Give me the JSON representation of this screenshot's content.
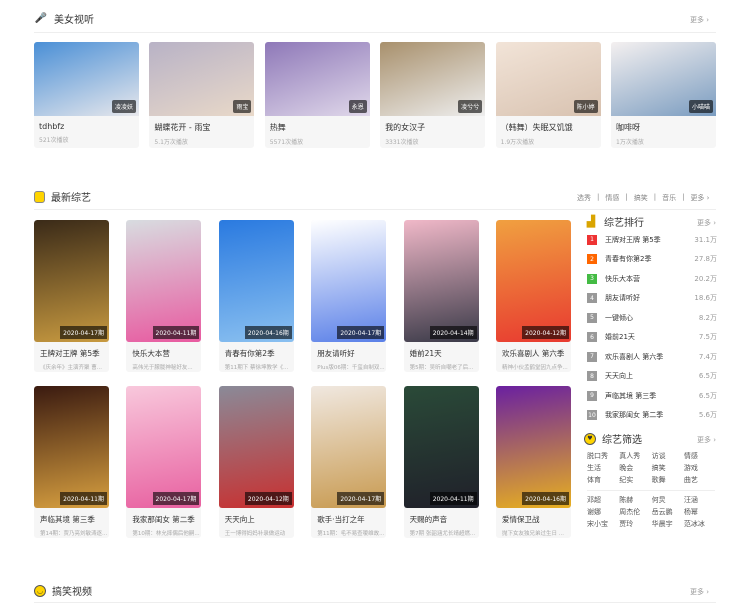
{
  "beauty": {
    "title": "美女视听",
    "more": "更多",
    "icon": "microphone-icon",
    "items": [
      {
        "title": "tdhbfz",
        "views": "521次播放",
        "tag": "凌凌妖",
        "colors": [
          "#4a8fd6",
          "#e8e8ec"
        ]
      },
      {
        "title": "蝴蝶花开 - 雨宝",
        "views": "5.1万次播放",
        "tag": "雨宝",
        "colors": [
          "#b8b2c6",
          "#e9d9c9"
        ]
      },
      {
        "title": "热舞",
        "views": "5571次播放",
        "tag": "永恩",
        "colors": [
          "#8e78b8",
          "#e0d8ea"
        ]
      },
      {
        "title": "我的女汉子",
        "views": "3331次播放",
        "tag": "凌兮兮",
        "colors": [
          "#a8906c",
          "#eeeeee"
        ]
      },
      {
        "title": "（韩舞）失眠又饥饿",
        "views": "1.9万次播放",
        "tag": "陈小婷",
        "colors": [
          "#f2e4d8",
          "#d8c2b0"
        ]
      },
      {
        "title": "咖啡呀",
        "views": "1万次播放",
        "tag": "小喵喵",
        "colors": [
          "#f4f0f0",
          "#7a9cc0"
        ]
      }
    ]
  },
  "variety": {
    "title": "最新综艺",
    "icon": "variety-icon",
    "categories": [
      "选秀",
      "情感",
      "搞笑",
      "音乐",
      "更多"
    ],
    "items": [
      {
        "title": "王牌对王牌 第5季",
        "desc": "《庆余年》主演齐聚 曹...",
        "date": "2020-04-17期",
        "colors": [
          "#3a2a18",
          "#c89a40"
        ]
      },
      {
        "title": "快乐大本营",
        "desc": "高伟光于朦胧神秘好友...",
        "date": "2020-04-11期",
        "colors": [
          "#d8dce0",
          "#e85aa0"
        ]
      },
      {
        "title": "青春有你第2季",
        "desc": "第11期下 蔡徐坤教学《...",
        "date": "2020-04-16期",
        "colors": [
          "#2a7ae0",
          "#8ac0f0"
        ]
      },
      {
        "title": "朋友请听好",
        "desc": "Plus版06期：千玺自制双...",
        "date": "2020-04-17期",
        "colors": [
          "#ffffff",
          "#5a80e8"
        ]
      },
      {
        "title": "婚前21天",
        "desc": "第5期：吴昕自嘲老了后...",
        "date": "2020-04-14期",
        "colors": [
          "#f0b8c8",
          "#3a3a48"
        ]
      },
      {
        "title": "欢乐喜剧人 第六季",
        "desc": "精神小伙孟鹤堂因九点争...",
        "date": "2020-04-12期",
        "colors": [
          "#f0a040",
          "#e83a30"
        ]
      },
      {
        "title": "声临其境 第三季",
        "desc": "第14期：贾乃亮刘敏涛逐...",
        "date": "2020-04-11期",
        "colors": [
          "#3a1a10",
          "#d8a040"
        ]
      },
      {
        "title": "我家那闺女 第二季",
        "desc": "第10期：林允摔偶后他嗣...",
        "date": "2020-04-17期",
        "colors": [
          "#f8c8dc",
          "#e860a0"
        ]
      },
      {
        "title": "天天向上",
        "desc": "王一博得妈妈补录做运动",
        "date": "2020-04-12期",
        "colors": [
          "#8a8a98",
          "#c83030"
        ]
      },
      {
        "title": "歌手·当打之年",
        "desc": "第11期：毛不易查嗄维故...",
        "date": "2020-04-17期",
        "colors": [
          "#f0e8e0",
          "#c89a50"
        ]
      },
      {
        "title": "天赐的声音",
        "desc": "第7期 张韶涵尤长靖超燃...",
        "date": "2020-04-11期",
        "colors": [
          "#2a4a38",
          "#20202a"
        ]
      },
      {
        "title": "爱情保卫战",
        "desc": "抛下女友独兄弟过生日 ...",
        "date": "2020-04-16期",
        "colors": [
          "#6a20a0",
          "#e8b020"
        ]
      }
    ]
  },
  "ranking": {
    "title": "综艺排行",
    "more": "更多",
    "icon": "bar-chart-icon",
    "rank_colors": [
      "#e33",
      "#f60",
      "#4b4",
      "#999"
    ],
    "items": [
      {
        "rank": "1",
        "name": "王牌对王牌 第5季",
        "count": "31.1万"
      },
      {
        "rank": "2",
        "name": "青春有你第2季",
        "count": "27.8万"
      },
      {
        "rank": "3",
        "name": "快乐大本营",
        "count": "20.2万"
      },
      {
        "rank": "4",
        "name": "朋友请听好",
        "count": "18.6万"
      },
      {
        "rank": "5",
        "name": "一键倾心",
        "count": "8.2万"
      },
      {
        "rank": "6",
        "name": "婚前21天",
        "count": "7.5万"
      },
      {
        "rank": "7",
        "name": "欢乐喜剧人 第六季",
        "count": "7.4万"
      },
      {
        "rank": "8",
        "name": "天天向上",
        "count": "6.5万"
      },
      {
        "rank": "9",
        "name": "声临其境 第三季",
        "count": "6.5万"
      },
      {
        "rank": "10",
        "name": "我家那闺女 第二季",
        "count": "5.6万"
      }
    ]
  },
  "filter": {
    "title": "综艺筛选",
    "more": "更多",
    "icon": "heart-badge-icon",
    "types": [
      "脱口秀",
      "真人秀",
      "访谈",
      "情感",
      "生活",
      "晚会",
      "搞笑",
      "游戏",
      "体育",
      "纪实",
      "歌舞",
      "曲艺"
    ],
    "people": [
      "邓超",
      "陈赫",
      "何炅",
      "汪涵",
      "谢娜",
      "周杰伦",
      "岳云鹏",
      "杨幂",
      "宋小宝",
      "贾玲",
      "华晨宇",
      "范冰冰"
    ]
  },
  "funny": {
    "title": "搞笑视频",
    "more": "更多",
    "icon": "smile-icon"
  }
}
